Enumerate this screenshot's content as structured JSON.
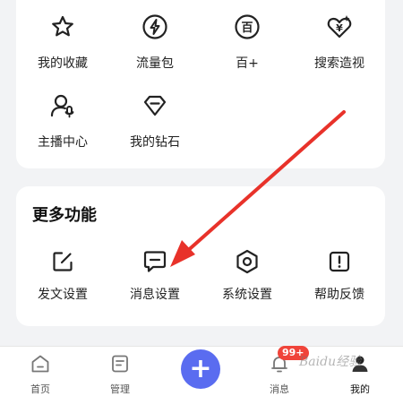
{
  "feature_grid": {
    "items": [
      {
        "label": "我的收藏",
        "icon": "star-icon"
      },
      {
        "label": "流量包",
        "icon": "lightning-icon"
      },
      {
        "label": "百+",
        "icon": "bai-plus-icon"
      },
      {
        "label": "搜索造视",
        "icon": "heart-yen-icon"
      },
      {
        "label": "主播中心",
        "icon": "anchor-person-icon"
      },
      {
        "label": "我的钻石",
        "icon": "diamond-icon"
      }
    ]
  },
  "more_features": {
    "title": "更多功能",
    "items": [
      {
        "label": "发文设置",
        "icon": "edit-square-icon"
      },
      {
        "label": "消息设置",
        "icon": "message-icon"
      },
      {
        "label": "系统设置",
        "icon": "gear-hexagon-icon"
      },
      {
        "label": "帮助反馈",
        "icon": "alert-square-icon"
      }
    ]
  },
  "bottom_nav": {
    "items": [
      {
        "label": "首页",
        "icon": "home-icon"
      },
      {
        "label": "管理",
        "icon": "manage-icon"
      },
      {
        "label": "消息",
        "icon": "bell-icon"
      },
      {
        "label": "我的",
        "icon": "avatar-icon"
      }
    ],
    "plus_label": "+",
    "badge": "99+"
  },
  "colors": {
    "accent": "#5a6cf0",
    "badge": "#f0443a",
    "arrow": "#e8322a"
  },
  "watermark": "Baidu经验"
}
